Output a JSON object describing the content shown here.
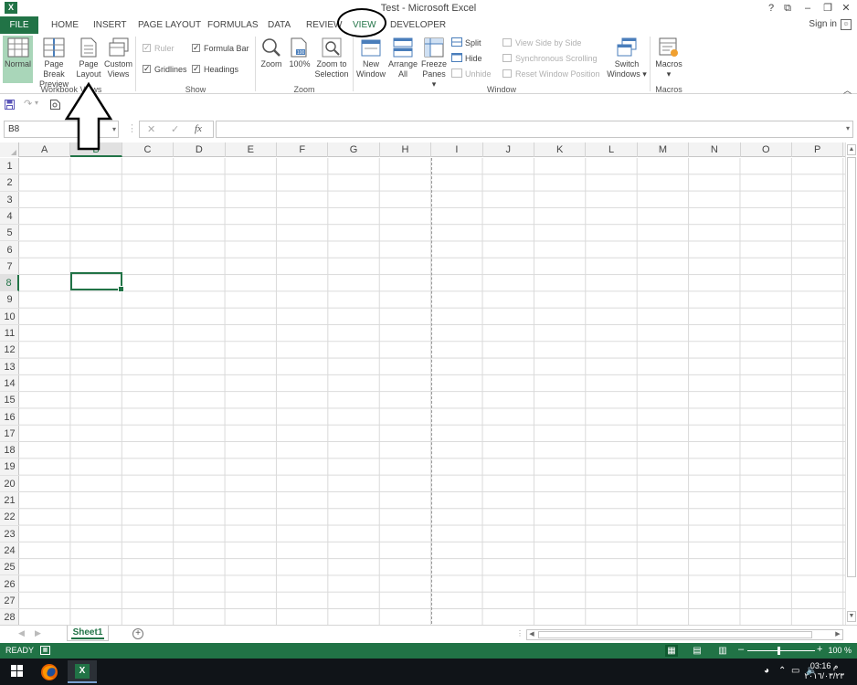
{
  "window": {
    "title": "Test - Microsoft Excel",
    "app_icon": "excel-icon",
    "controls": [
      "?",
      "⧉",
      "–",
      "❐",
      "✕"
    ]
  },
  "ribbon_tabs": {
    "file": "FILE",
    "items": [
      "HOME",
      "INSERT",
      "PAGE LAYOUT",
      "FORMULAS",
      "DATA",
      "REVIEW",
      "VIEW",
      "DEVELOPER"
    ],
    "active": "VIEW",
    "sign_in": "Sign in"
  },
  "ribbon": {
    "workbook_views": {
      "label": "Workbook Views",
      "buttons": [
        {
          "line1": "Normal",
          "line2": "",
          "selected": true
        },
        {
          "line1": "Page Break",
          "line2": "Preview"
        },
        {
          "line1": "Page",
          "line2": "Layout"
        },
        {
          "line1": "Custom",
          "line2": "Views"
        }
      ]
    },
    "show": {
      "label": "Show",
      "ruler": {
        "label": "Ruler",
        "checked": true,
        "enabled": false
      },
      "formula_bar": {
        "label": "Formula Bar",
        "checked": true
      },
      "gridlines": {
        "label": "Gridlines",
        "checked": true
      },
      "headings": {
        "label": "Headings",
        "checked": true
      }
    },
    "zoom": {
      "label": "Zoom",
      "buttons": [
        {
          "line1": "Zoom",
          "line2": ""
        },
        {
          "line1": "100%",
          "line2": ""
        },
        {
          "line1": "Zoom to",
          "line2": "Selection"
        }
      ]
    },
    "window": {
      "label": "Window",
      "new_window": {
        "line1": "New",
        "line2": "Window"
      },
      "arrange_all": {
        "line1": "Arrange",
        "line2": "All"
      },
      "freeze_panes": {
        "line1": "Freeze",
        "line2": "Panes ▾"
      },
      "split": "Split",
      "hide": "Hide",
      "unhide": "Unhide",
      "view_side_by_side": "View Side by Side",
      "synchronous_scrolling": "Synchronous Scrolling",
      "reset_window_position": "Reset Window Position",
      "switch_windows": {
        "line1": "Switch",
        "line2": "Windows ▾"
      }
    },
    "macros": {
      "label": "Macros",
      "button": {
        "line1": "Macros",
        "line2": "▾"
      }
    }
  },
  "formula_bar": {
    "name_box": "B8",
    "cancel": "✕",
    "enter": "✓",
    "fx": "fx",
    "value": ""
  },
  "grid": {
    "columns": [
      "A",
      "B",
      "C",
      "D",
      "E",
      "F",
      "G",
      "H",
      "I",
      "J",
      "K",
      "L",
      "M",
      "N",
      "O",
      "P"
    ],
    "rows": [
      "1",
      "2",
      "3",
      "4",
      "5",
      "6",
      "7",
      "8",
      "9",
      "10",
      "11",
      "12",
      "13",
      "14",
      "15",
      "16",
      "17",
      "18",
      "19",
      "20",
      "21",
      "22",
      "23",
      "24",
      "25",
      "26",
      "27",
      "28"
    ],
    "active_column": "B",
    "active_row": "8"
  },
  "sheets": {
    "tabs": [
      "Sheet1"
    ],
    "active": "Sheet1",
    "add": "+"
  },
  "status": {
    "text": "READY",
    "zoom": "100 %",
    "zoom_minus": "–",
    "zoom_plus": "+"
  },
  "taskbar": {
    "time": "03:16 م",
    "date": "٢٠١٦/٠٣/٢٣"
  },
  "colors": {
    "excel_green": "#217346",
    "selected_view": "#a9d6b9"
  }
}
